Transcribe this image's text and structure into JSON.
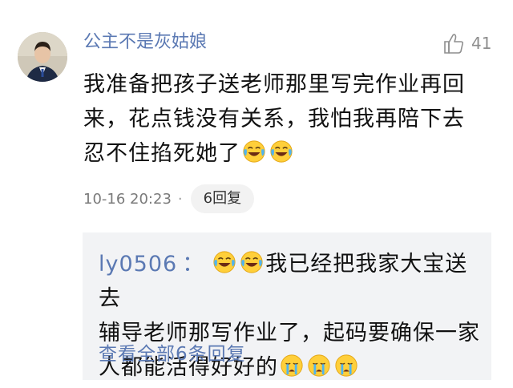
{
  "comment": {
    "username": "公主不是灰姑娘",
    "likes": "41",
    "text_line1": "我准备把孩子送老师那里写完作业再回",
    "text_line2": "来，花点钱没有关系，我怕我再陪下去",
    "text_line3": "忍不住掐死她了",
    "timestamp": "10-16 20:23",
    "separator": "·",
    "reply_count_label": "6回复"
  },
  "reply": {
    "username": "ly0506",
    "colon": "：",
    "text_line1": "我已经把我家大宝送去",
    "text_line2": "辅导老师那写作业了，起码要确保一家",
    "text_line3": "人都能活得好好的",
    "view_all": "查看全部6条回复"
  },
  "icons": {
    "like": "thumbs-up-icon",
    "laugh_cry": "laugh-cry-emoji",
    "cry": "crying-emoji"
  },
  "colors": {
    "username": "#5b79b3",
    "reply_bg": "#f2f3f5"
  }
}
